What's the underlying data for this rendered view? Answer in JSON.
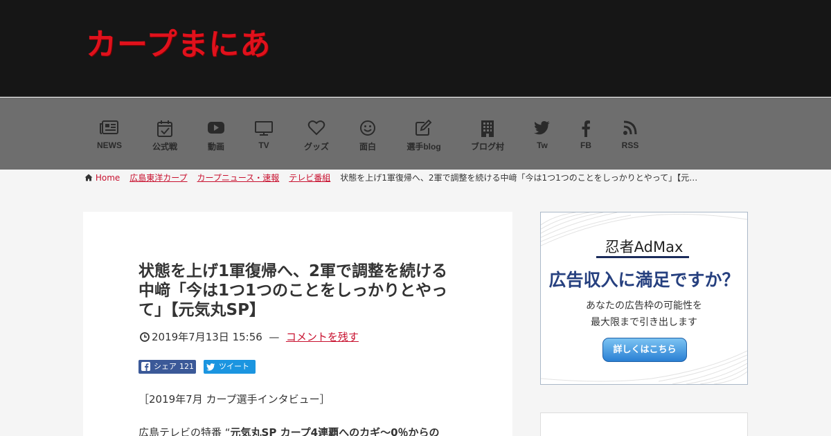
{
  "site": {
    "logo": "カープまにあ"
  },
  "nav": [
    {
      "label": "NEWS",
      "icon": "newspaper-icon"
    },
    {
      "label": "公式戦",
      "icon": "calendar-check-icon"
    },
    {
      "label": "動画",
      "icon": "youtube-icon"
    },
    {
      "label": "TV",
      "icon": "tv-icon"
    },
    {
      "label": "グッズ",
      "icon": "heart-icon"
    },
    {
      "label": "面白",
      "icon": "smile-icon"
    },
    {
      "label": "選手blog",
      "icon": "edit-icon"
    },
    {
      "label": "ブログ村",
      "icon": "building-icon"
    },
    {
      "label": "Tw",
      "icon": "twitter-icon"
    },
    {
      "label": "FB",
      "icon": "facebook-icon"
    },
    {
      "label": "RSS",
      "icon": "rss-icon"
    }
  ],
  "breadcrumb": {
    "home": "Home",
    "items": [
      "広島東洋カープ",
      "カープニュース・速報",
      "テレビ番組"
    ],
    "current": "状態を上げ1軍復帰へ、2軍で調整を続ける中﨑「今は1つ1つのことをしっかりとやって」【元…"
  },
  "article": {
    "title": "状態を上げ1軍復帰へ、2軍で調整を続ける中﨑「今は1つ1つのことをしっかりとやって」【元気丸SP】",
    "date": "2019年7月13日 15:56",
    "dash": "—",
    "comment_link": "コメントを残す",
    "share": {
      "fb_label": "シェア",
      "fb_count": "121",
      "tw_label": "ツイート"
    },
    "para1": "［2019年7月 カープ選手インタビュー］",
    "para2_prefix": "広島テレビの特番 “",
    "para2_bold": "元気丸SP カープ4連覇へのカギ～0％からの"
  },
  "ad": {
    "brand": "忍者AdMax",
    "headline": "広告収入に満足ですか？",
    "line1": "あなたの広告枠の可能性を",
    "line2": "最大限まで引き出します",
    "button": "詳しくはこちら"
  },
  "colors": {
    "header_bg": "#161616",
    "nav_bg": "#6e6e6e",
    "logo": "#e0111c",
    "link": "#c8102e",
    "ad_headline": "#26407f"
  }
}
